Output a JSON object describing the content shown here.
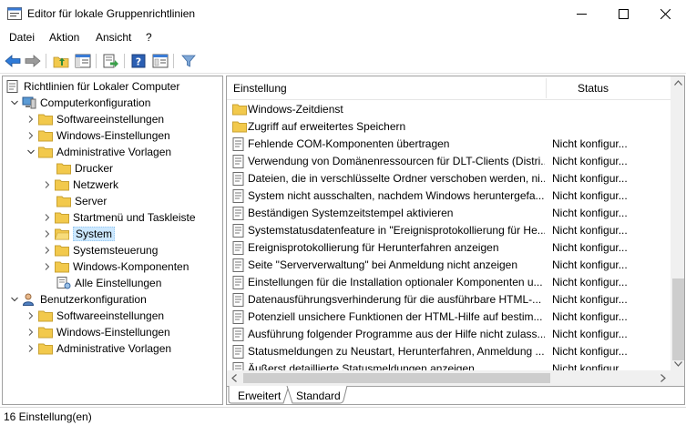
{
  "window": {
    "title": "Editor für lokale Gruppenrichtlinien"
  },
  "menu": [
    "Datei",
    "Aktion",
    "Ansicht",
    "?"
  ],
  "toolbar": {
    "icons": [
      "back-arrow-icon",
      "forward-arrow-icon",
      "up-folder-icon",
      "show-hide-tree-icon",
      "export-list-icon",
      "help-icon",
      "properties-icon",
      "filter-icon"
    ]
  },
  "tree": {
    "items": [
      {
        "label": "Richtlinien für Lokaler Computer",
        "icon": "policy-icon"
      },
      {
        "label": "Computerkonfiguration",
        "icon": "computer-icon",
        "expanded": true
      },
      {
        "label": "Softwareeinstellungen",
        "icon": "folder-icon"
      },
      {
        "label": "Windows-Einstellungen",
        "icon": "folder-icon"
      },
      {
        "label": "Administrative Vorlagen",
        "icon": "folder-icon",
        "expanded": true
      },
      {
        "label": "Drucker",
        "icon": "folder-icon"
      },
      {
        "label": "Netzwerk",
        "icon": "folder-icon"
      },
      {
        "label": "Server",
        "icon": "folder-icon"
      },
      {
        "label": "Startmenü und Taskleiste",
        "icon": "folder-icon"
      },
      {
        "label": "System",
        "icon": "folder-icon",
        "selected": true
      },
      {
        "label": "Systemsteuerung",
        "icon": "folder-icon"
      },
      {
        "label": "Windows-Komponenten",
        "icon": "folder-icon"
      },
      {
        "label": "Alle Einstellungen",
        "icon": "all-settings-icon"
      },
      {
        "label": "Benutzerkonfiguration",
        "icon": "user-icon",
        "expanded": true
      },
      {
        "label": "Softwareeinstellungen",
        "icon": "folder-icon"
      },
      {
        "label": "Windows-Einstellungen",
        "icon": "folder-icon"
      },
      {
        "label": "Administrative Vorlagen",
        "icon": "folder-icon"
      }
    ]
  },
  "list": {
    "columns": {
      "setting": "Einstellung",
      "status": "Status"
    },
    "rows": [
      {
        "name": "Windows-Zeitdienst",
        "status": "",
        "icon": "folder-icon"
      },
      {
        "name": "Zugriff auf erweitertes Speichern",
        "status": "",
        "icon": "folder-icon"
      },
      {
        "name": "Fehlende COM-Komponenten übertragen",
        "status": "Nicht konfigur...",
        "icon": "setting-icon"
      },
      {
        "name": "Verwendung von Domänenressourcen für DLT-Clients (Distri...",
        "status": "Nicht konfigur...",
        "icon": "setting-icon"
      },
      {
        "name": "Dateien, die in verschlüsselte Ordner verschoben werden, ni...",
        "status": "Nicht konfigur...",
        "icon": "setting-icon"
      },
      {
        "name": "System nicht ausschalten, nachdem Windows heruntergefa...",
        "status": "Nicht konfigur...",
        "icon": "setting-icon"
      },
      {
        "name": "Beständigen Systemzeitstempel aktivieren",
        "status": "Nicht konfigur...",
        "icon": "setting-icon"
      },
      {
        "name": "Systemstatusdatenfeature in \"Ereignisprotokollierung für He...",
        "status": "Nicht konfigur...",
        "icon": "setting-icon"
      },
      {
        "name": "Ereignisprotokollierung für Herunterfahren anzeigen",
        "status": "Nicht konfigur...",
        "icon": "setting-icon"
      },
      {
        "name": "Seite \"Serververwaltung\" bei Anmeldung nicht anzeigen",
        "status": "Nicht konfigur...",
        "icon": "setting-icon"
      },
      {
        "name": "Einstellungen für die Installation optionaler Komponenten u...",
        "status": "Nicht konfigur...",
        "icon": "setting-icon"
      },
      {
        "name": "Datenausführungsverhinderung für die ausführbare HTML-...",
        "status": "Nicht konfigur...",
        "icon": "setting-icon"
      },
      {
        "name": "Potenziell unsichere Funktionen der HTML-Hilfe auf bestim...",
        "status": "Nicht konfigur...",
        "icon": "setting-icon"
      },
      {
        "name": "Ausführung folgender Programme aus der Hilfe nicht zulass...",
        "status": "Nicht konfigur...",
        "icon": "setting-icon"
      },
      {
        "name": "Statusmeldungen zu Neustart, Herunterfahren, Anmeldung ...",
        "status": "Nicht konfigur...",
        "icon": "setting-icon"
      },
      {
        "name": "Äußerst detaillierte Statusmeldungen anzeigen",
        "status": "Nicht konfigur...",
        "icon": "setting-icon"
      }
    ]
  },
  "tabs": [
    "Erweitert",
    "Standard"
  ],
  "statusbar": {
    "text": "16 Einstellung(en)"
  },
  "colors": {
    "selection": "#cce8ff",
    "accent": "#1e6fd0",
    "folder": "#f2c94c"
  }
}
